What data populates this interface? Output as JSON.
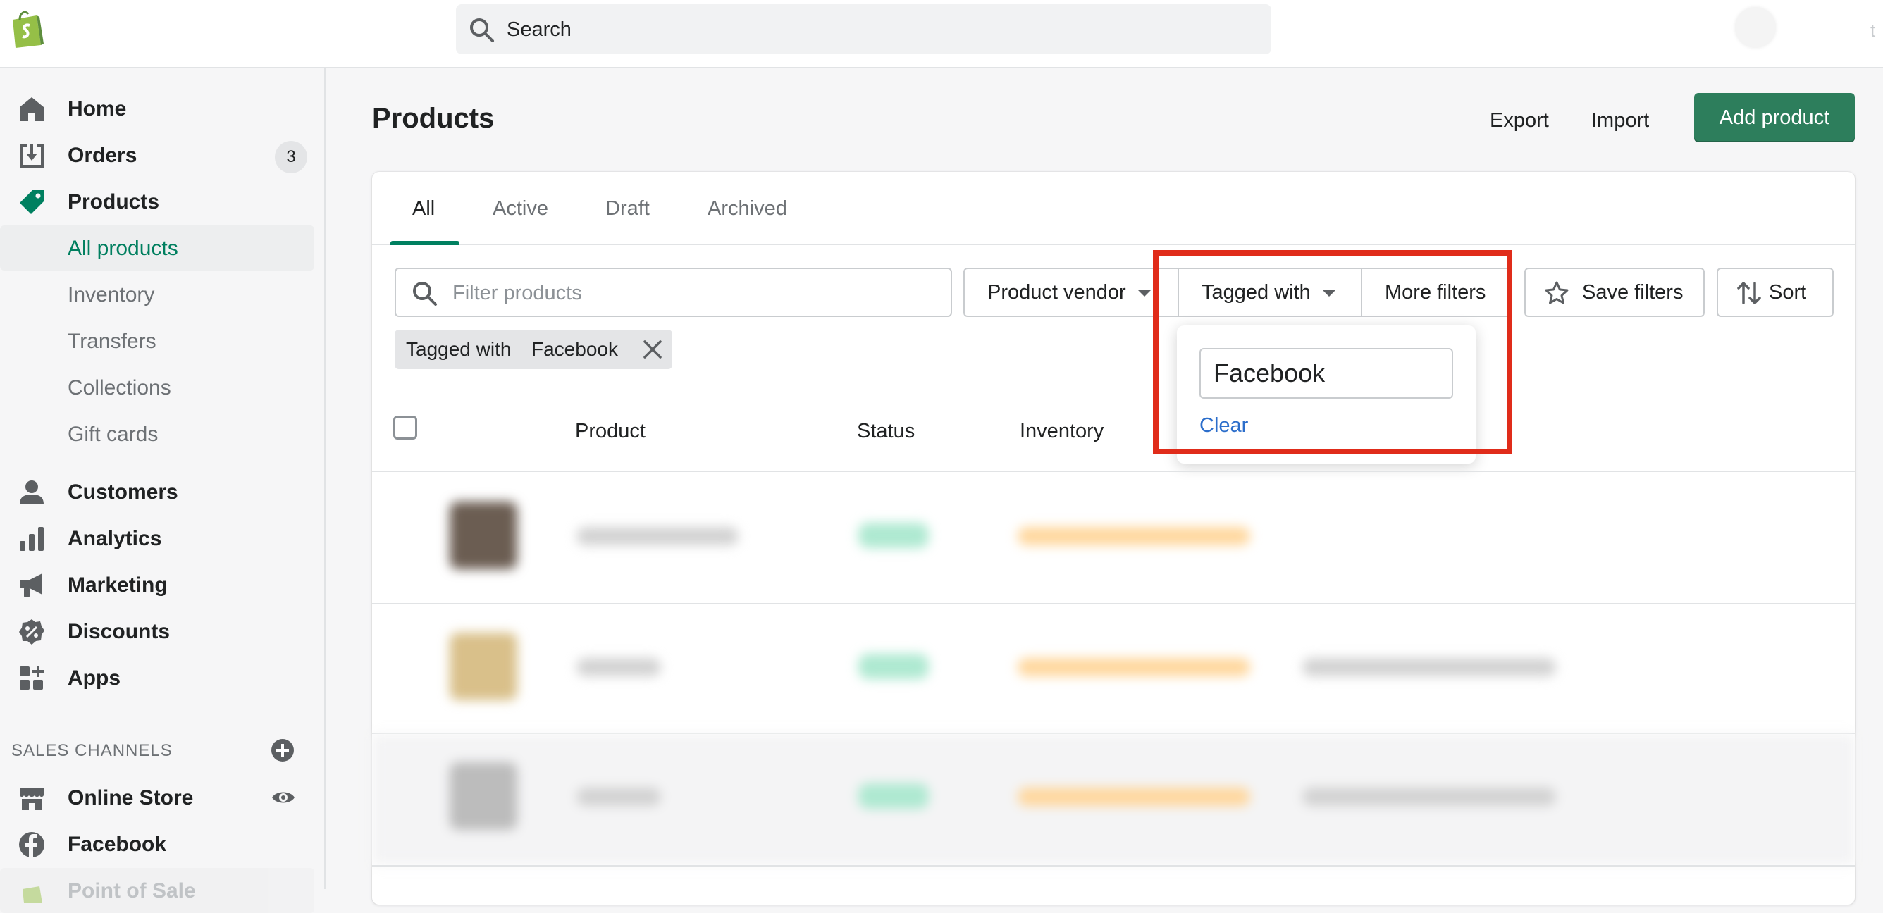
{
  "topbar": {
    "search_placeholder": "Search",
    "corner_text": "t"
  },
  "sidebar": {
    "items": [
      {
        "label": "Home",
        "icon": "home-icon"
      },
      {
        "label": "Orders",
        "icon": "orders-icon",
        "badge": "3"
      },
      {
        "label": "Products",
        "icon": "tag-icon"
      },
      {
        "label": "All products"
      },
      {
        "label": "Inventory"
      },
      {
        "label": "Transfers"
      },
      {
        "label": "Collections"
      },
      {
        "label": "Gift cards"
      },
      {
        "label": "Customers",
        "icon": "person-icon"
      },
      {
        "label": "Analytics",
        "icon": "bar-chart-icon"
      },
      {
        "label": "Marketing",
        "icon": "megaphone-icon"
      },
      {
        "label": "Discounts",
        "icon": "discount-icon"
      },
      {
        "label": "Apps",
        "icon": "apps-icon"
      }
    ],
    "sales_channels_title": "SALES CHANNELS",
    "channels": [
      {
        "label": "Online Store",
        "icon": "store-icon"
      },
      {
        "label": "Facebook",
        "icon": "facebook-icon"
      },
      {
        "label": "Point of Sale",
        "icon": "pos-icon"
      }
    ]
  },
  "header": {
    "title": "Products",
    "export_label": "Export",
    "import_label": "Import",
    "add_label": "Add product"
  },
  "tabs": [
    "All",
    "Active",
    "Draft",
    "Archived"
  ],
  "filters": {
    "search_placeholder": "Filter products",
    "vendor_label": "Product vendor",
    "tagged_label": "Tagged with",
    "more_label": "More filters",
    "save_label": "Save filters",
    "sort_label": "Sort",
    "chip_key": "Tagged with",
    "chip_value": "Facebook",
    "popover_value": "Facebook",
    "clear_label": "Clear"
  },
  "table": {
    "columns": [
      "Product",
      "Status",
      "Inventory"
    ]
  },
  "colors": {
    "accent": "#008060",
    "primary_button": "#2d7e5c",
    "highlight": "#e02c1a",
    "link": "#2c6ecb"
  }
}
